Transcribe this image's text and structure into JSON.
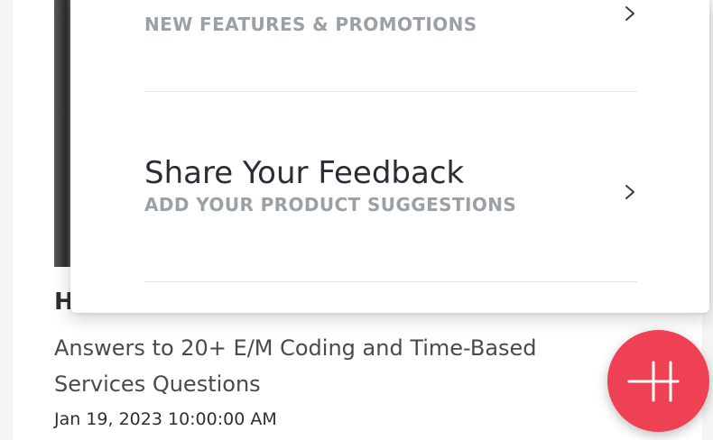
{
  "background_article": {
    "title_partial": "H",
    "description": "Answers to 20+ E/M Coding and Time-Based Services Questions",
    "date": "Jan 19, 2023 10:00:00 AM"
  },
  "menu": {
    "items": [
      {
        "title": "",
        "subtitle": "NEW FEATURES & PROMOTIONS",
        "icon": "chevron-right-icon"
      },
      {
        "title": "Share Your Feedback",
        "subtitle": "ADD YOUR PRODUCT SUGGESTIONS",
        "icon": "chevron-right-icon"
      }
    ]
  },
  "fab": {
    "icon": "plus-icon",
    "color": "#ef4154"
  },
  "colors": {
    "title_text": "#2b2d36",
    "subtitle_text": "#9aa0a8",
    "divider": "#e2e4e8",
    "accent": "#ef4154"
  }
}
